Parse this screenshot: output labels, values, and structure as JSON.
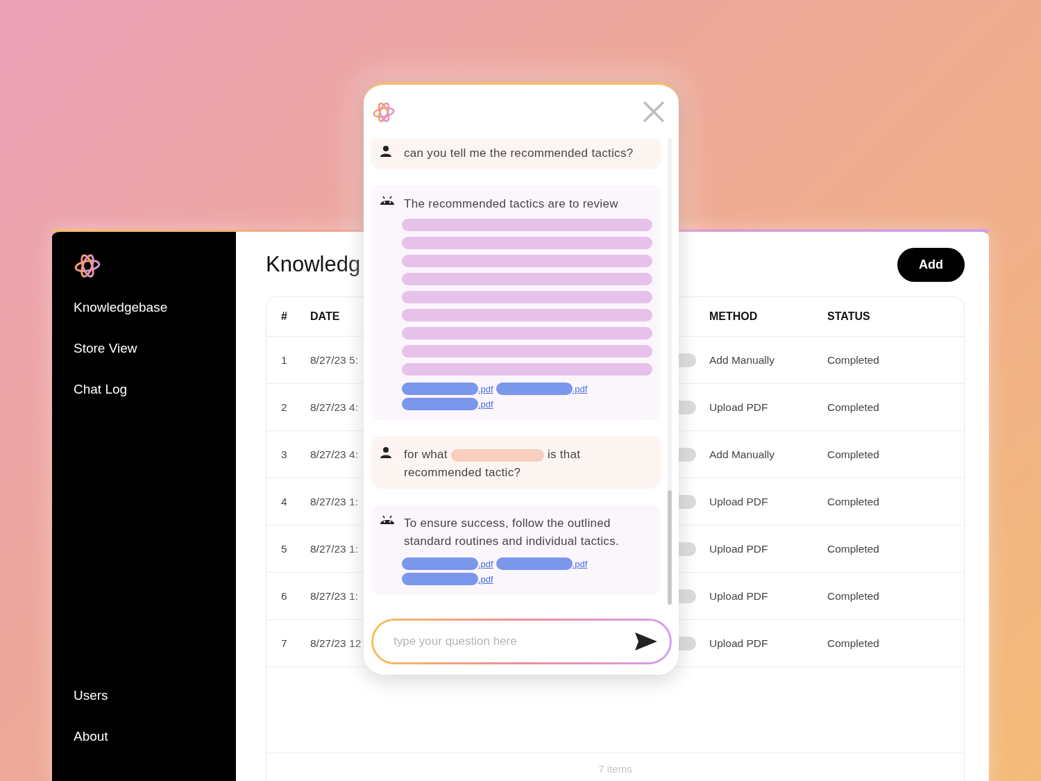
{
  "sidebar": {
    "items": [
      {
        "label": "Knowledgebase"
      },
      {
        "label": "Store View"
      },
      {
        "label": "Chat Log"
      }
    ],
    "bottom_items": [
      {
        "label": "Users"
      },
      {
        "label": "About"
      }
    ]
  },
  "page": {
    "title": "Knowledg",
    "add_button": "Add"
  },
  "table": {
    "columns": [
      "#",
      "DATE",
      "METHOD",
      "STATUS"
    ],
    "rows": [
      {
        "number": "1",
        "date": "8/27/23 5:",
        "method": "Add Manually",
        "status": "Completed"
      },
      {
        "number": "2",
        "date": "8/27/23 4:",
        "method": "Upload PDF",
        "status": "Completed"
      },
      {
        "number": "3",
        "date": "8/27/23 4:",
        "method": "Add Manually",
        "status": "Completed"
      },
      {
        "number": "4",
        "date": "8/27/23 1:",
        "method": "Upload PDF",
        "status": "Completed"
      },
      {
        "number": "5",
        "date": "8/27/23 1:",
        "method": "Upload PDF",
        "status": "Completed"
      },
      {
        "number": "6",
        "date": "8/27/23 1:",
        "method": "Upload PDF",
        "status": "Completed"
      },
      {
        "number": "7",
        "date": "8/27/23 12",
        "method": "Upload PDF",
        "status": "Completed"
      }
    ],
    "footer": "7 items"
  },
  "chat": {
    "messages": [
      {
        "kind": "user",
        "parts": [
          {
            "kind": "text",
            "text": "can you tell me the recommended tactics?"
          }
        ]
      },
      {
        "kind": "bot",
        "parts": [
          {
            "kind": "text",
            "text": "The recommended tactics are to review"
          },
          {
            "kind": "redacted_line"
          },
          {
            "kind": "redacted_line"
          },
          {
            "kind": "redacted_line"
          },
          {
            "kind": "redacted_line"
          },
          {
            "kind": "redacted_line"
          },
          {
            "kind": "redacted_line"
          },
          {
            "kind": "redacted_line"
          },
          {
            "kind": "redacted_line"
          },
          {
            "kind": "redacted_line"
          }
        ],
        "sources": [
          {
            "text": ".pdf"
          },
          {
            "text": ".pdf"
          },
          {
            "text": ".pdf"
          }
        ]
      },
      {
        "kind": "user",
        "parts": [
          {
            "kind": "text",
            "text": "for what"
          },
          {
            "kind": "redacted"
          },
          {
            "kind": "text",
            "text": "is that recommended tactic?"
          }
        ]
      },
      {
        "kind": "bot",
        "parts": [
          {
            "kind": "text",
            "text": "To ensure success, follow the outlined standard routines and individual tactics."
          }
        ],
        "sources": [
          {
            "text": ".pdf"
          },
          {
            "text": ".pdf"
          },
          {
            "text": ".pdf"
          }
        ]
      }
    ],
    "input": {
      "placeholder": "type your question here"
    }
  }
}
